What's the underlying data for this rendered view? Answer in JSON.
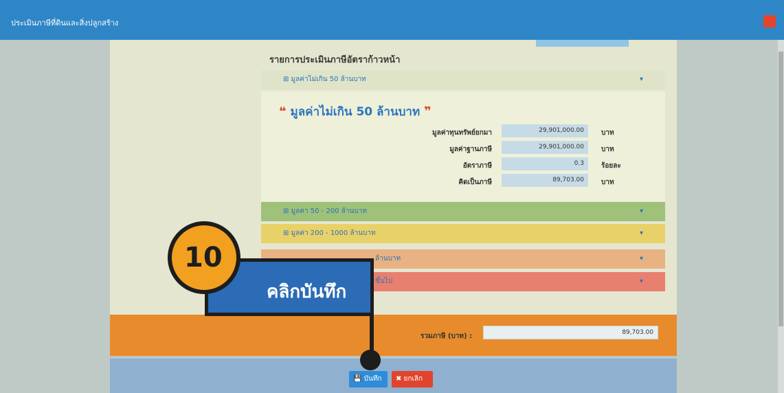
{
  "window": {
    "title": "ประเมินภาษีที่ดินและสิ่งปลูกสร้าง"
  },
  "section": {
    "heading": "รายการประเมินภาษีอัตราก้าวหน้า"
  },
  "accordion": [
    {
      "label": "⊞ มูลค่าไม่เกิน 50 ล้านบาท",
      "chevron": "▾"
    },
    {
      "label": "⊞ มูลค่า 50 - 200 ล้านบาท",
      "chevron": "▾"
    },
    {
      "label": "⊞ มูลค่า 200 - 1000 ล้านบาท",
      "chevron": "▾"
    },
    {
      "label": "ล้านบาท",
      "chevron": "▾"
    },
    {
      "label": "ขึ้นไป",
      "chevron": "▾"
    }
  ],
  "detail": {
    "quote_open": "❝",
    "heading": "มูลค่าไม่เกิน 50 ล้านบาท",
    "quote_close": "❞",
    "rows": [
      {
        "label": "มูลค่าทุนทรัพย์ยกมา",
        "value": "29,901,000.00",
        "unit": "บาท"
      },
      {
        "label": "มูลค่าฐานภาษี",
        "value": "29,901,000.00",
        "unit": "บาท"
      },
      {
        "label": "อัตราภาษี",
        "value": "0.3",
        "unit": "ร้อยละ"
      },
      {
        "label": "คิดเป็นภาษี",
        "value": "89,703.00",
        "unit": "บาท"
      }
    ]
  },
  "total": {
    "label": "รวมภาษี (บาท) :",
    "value": "89,703.00"
  },
  "footer": {
    "save_label": "💾 บันทึก",
    "cancel_label": "✖ ยกเลิก"
  },
  "callout": {
    "step": "10",
    "text": "คลิกบันทึก"
  },
  "colors": {
    "titlebar": "#2f86c7",
    "accent_orange": "#e88b2c",
    "callout_blue": "#2c6bb5",
    "badge_orange": "#f2a020"
  }
}
